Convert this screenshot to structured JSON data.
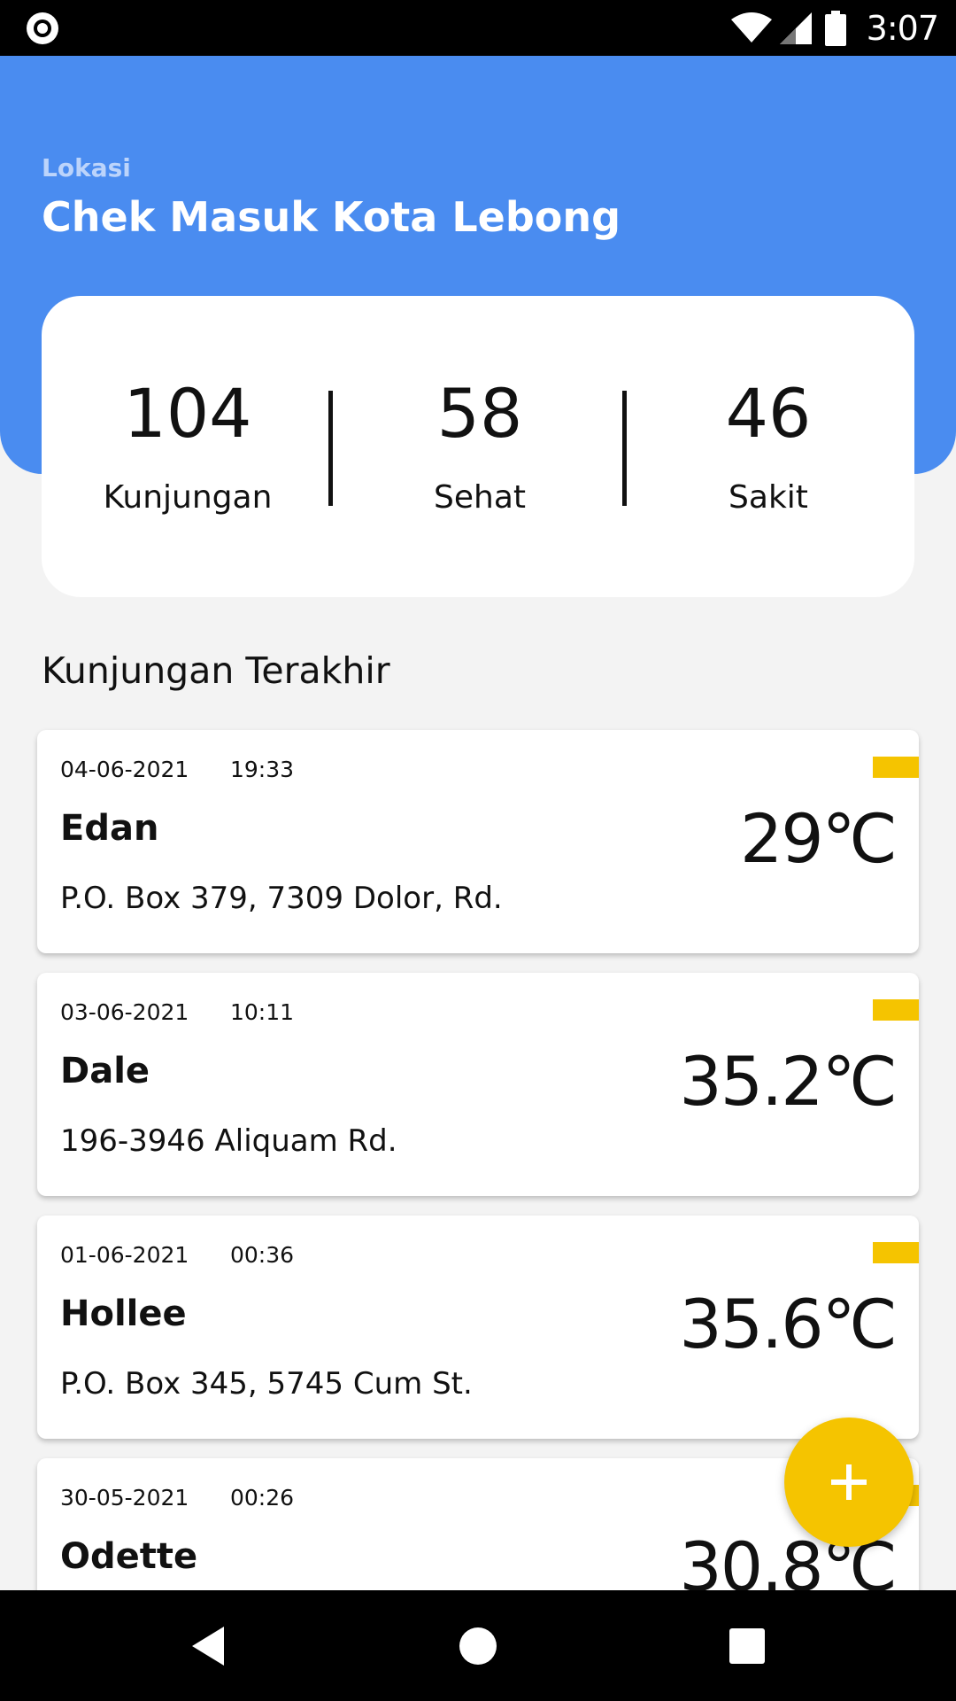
{
  "status_bar": {
    "time": "3:07",
    "icons": [
      "screen-record-icon",
      "wifi-icon",
      "signal-icon",
      "battery-icon"
    ]
  },
  "header": {
    "label": "Lokasi",
    "title": "Chek Masuk Kota Lebong",
    "color": "#4a8cf0"
  },
  "stats": {
    "visits": {
      "value": "104",
      "label": "Kunjungan"
    },
    "healthy": {
      "value": "58",
      "label": "Sehat"
    },
    "sick": {
      "value": "46",
      "label": "Sakit"
    }
  },
  "recent": {
    "title": "Kunjungan Terakhir",
    "items": [
      {
        "date": "04-06-2021",
        "time": "19:33",
        "name": "Edan",
        "address": "P.O. Box 379, 7309 Dolor, Rd.",
        "temperature": "29℃"
      },
      {
        "date": "03-06-2021",
        "time": "10:11",
        "name": "Dale",
        "address": "196-3946 Aliquam Rd.",
        "temperature": "35.2℃"
      },
      {
        "date": "01-06-2021",
        "time": "00:36",
        "name": "Hollee",
        "address": "P.O. Box 345, 5745 Cum St.",
        "temperature": "35.6℃"
      },
      {
        "date": "30-05-2021",
        "time": "00:26",
        "name": "Odette",
        "address": "",
        "temperature": "30.8℃"
      }
    ]
  },
  "fab": {
    "icon": "plus-icon",
    "color": "#f5c400"
  },
  "nav_bar": {
    "icons": [
      "back-icon",
      "home-icon",
      "recents-icon"
    ]
  }
}
